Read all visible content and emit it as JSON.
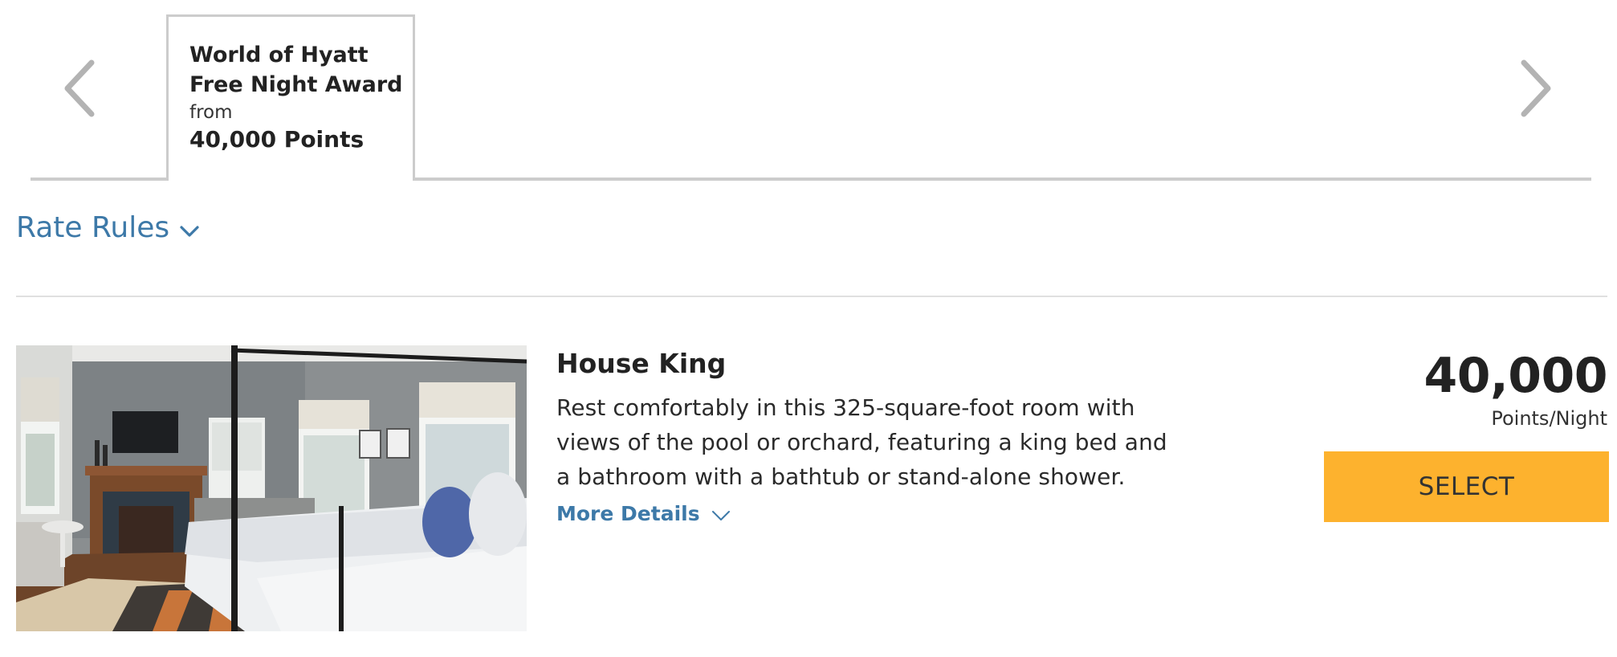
{
  "carousel": {
    "prev_icon": "chevron-left-icon",
    "next_icon": "chevron-right-icon",
    "tabs": [
      {
        "name": "World of Hyatt Free Night Award",
        "from_label": "from",
        "points": "40,000 Points",
        "selected": true
      }
    ]
  },
  "rate_rules": {
    "label": "Rate Rules",
    "icon": "chevron-down-icon"
  },
  "room": {
    "name": "House King",
    "description": "Rest comfortably in this 325-square-foot room with views of the pool or orchard, featuring a king bed and a bathroom with a bathtub or stand-alone shower.",
    "more_details_label": "More Details",
    "more_details_icon": "chevron-down-icon",
    "image": "bedroom-photo",
    "price": {
      "amount": "40,000",
      "unit": "Points/Night"
    },
    "select_label": "SELECT"
  },
  "colors": {
    "link_blue": "#3d79a8",
    "select_yellow": "#fdb22e",
    "tab_border": "#cccccc",
    "divider": "#e0e0e0"
  }
}
